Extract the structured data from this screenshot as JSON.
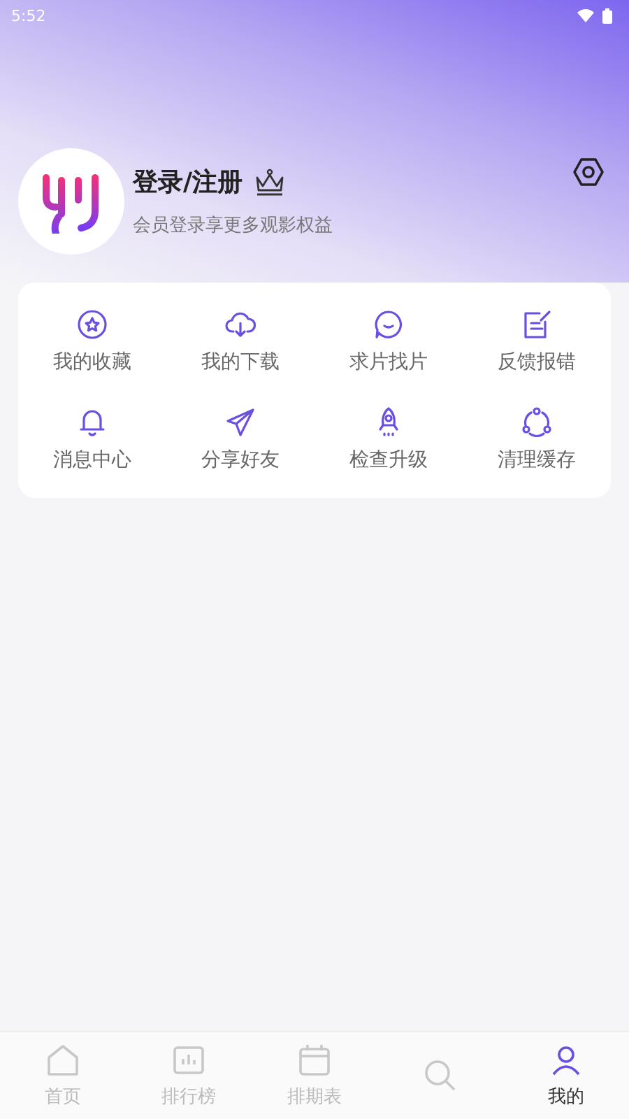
{
  "status_bar": {
    "time": "5:52"
  },
  "profile": {
    "name": "登录/注册",
    "subtitle": "会员登录享更多观影权益"
  },
  "features": [
    {
      "label": "我的收藏"
    },
    {
      "label": "我的下载"
    },
    {
      "label": "求片找片"
    },
    {
      "label": "反馈报错"
    },
    {
      "label": "消息中心"
    },
    {
      "label": "分享好友"
    },
    {
      "label": "检查升级"
    },
    {
      "label": "清理缓存"
    }
  ],
  "nav": [
    {
      "label": "首页",
      "selected": false
    },
    {
      "label": "排行榜",
      "selected": false
    },
    {
      "label": "排期表",
      "selected": false
    },
    {
      "selected": false
    },
    {
      "label": "我的",
      "selected": true
    }
  ]
}
